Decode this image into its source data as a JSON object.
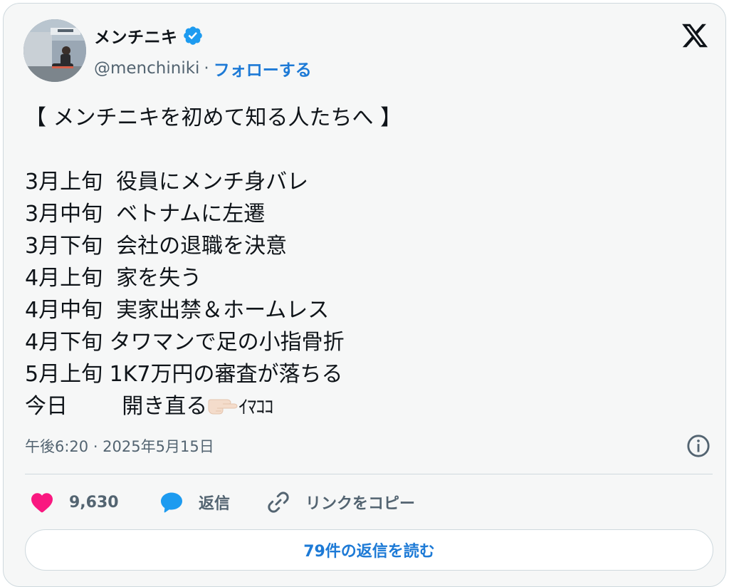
{
  "author": {
    "display_name": "メンチニキ",
    "handle": "@menchiniki",
    "separator": "·",
    "follow_label": "フォローする"
  },
  "tweet": {
    "lines": [
      "【 メンチニキを初めて知る人たちへ 】",
      "",
      "3月上旬  役員にメンチ身バレ",
      "3月中旬  ベトナムに左遷",
      "3月下旬  会社の退職を決意",
      "4月上旬  家を失う",
      "4月中旬  実家出禁＆ホームレス",
      "4月下旬 タワマンで足の小指骨折",
      "5月上旬 1K7万円の審査が落ちる",
      "今日        開き直る"
    ],
    "last_line_suffix": "ｲﾏｺｺ",
    "timestamp": "午後6:20 · 2025年5月15日"
  },
  "actions": {
    "like_count": "9,630",
    "reply_label": "返信",
    "copy_link_label": "リンクをコピー"
  },
  "read_replies_label": "79件の返信を読む",
  "colors": {
    "accent_blue": "#1d7ad6",
    "like_pink": "#f91880",
    "verified_blue": "#1d9bf0",
    "card_background": "#f6f7f7",
    "secondary_text": "#536471"
  },
  "icons": {
    "verified": "verified-badge-icon",
    "x_logo": "x-logo-icon",
    "info": "info-icon",
    "like": "heart-icon",
    "reply": "speech-bubble-icon",
    "copy_link": "link-icon",
    "pointer": "pointing-hand-icon"
  }
}
